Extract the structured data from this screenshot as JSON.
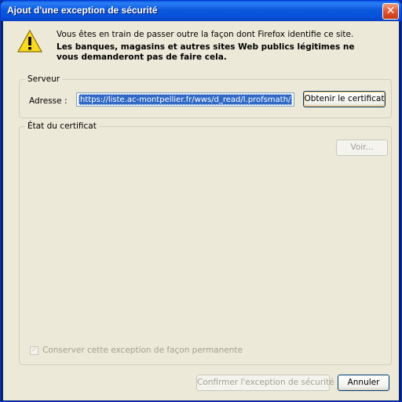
{
  "window": {
    "title": "Ajout d'une exception de sécurité",
    "close_glyph": "✕"
  },
  "warning": {
    "icon": "warning-triangle-icon",
    "line1": "Vous êtes en train de passer outre la façon dont Firefox identifie ce site.",
    "line2": "Les banques, magasins et autres sites Web publics légitimes ne vous demanderont pas de faire cela."
  },
  "server": {
    "group_label": "Serveur",
    "address_label": "Adresse :",
    "address_value": "https://liste.ac-montpellier.fr/wws/d_read/l.profsmath/",
    "get_cert_label": "Obtenir le certificat"
  },
  "cert_status": {
    "group_label": "État du certificat",
    "view_label": "Voir..."
  },
  "permanent": {
    "label": "Conserver cette exception de façon permanente",
    "checked": true
  },
  "buttons": {
    "confirm_label": "Confirmer l'exception de sécurité",
    "cancel_label": "Annuler"
  },
  "colors": {
    "titlebar": "#0a5fe0",
    "dialog_bg": "#ece9d8",
    "selection": "#316ac5",
    "close_button": "#e25a36"
  }
}
